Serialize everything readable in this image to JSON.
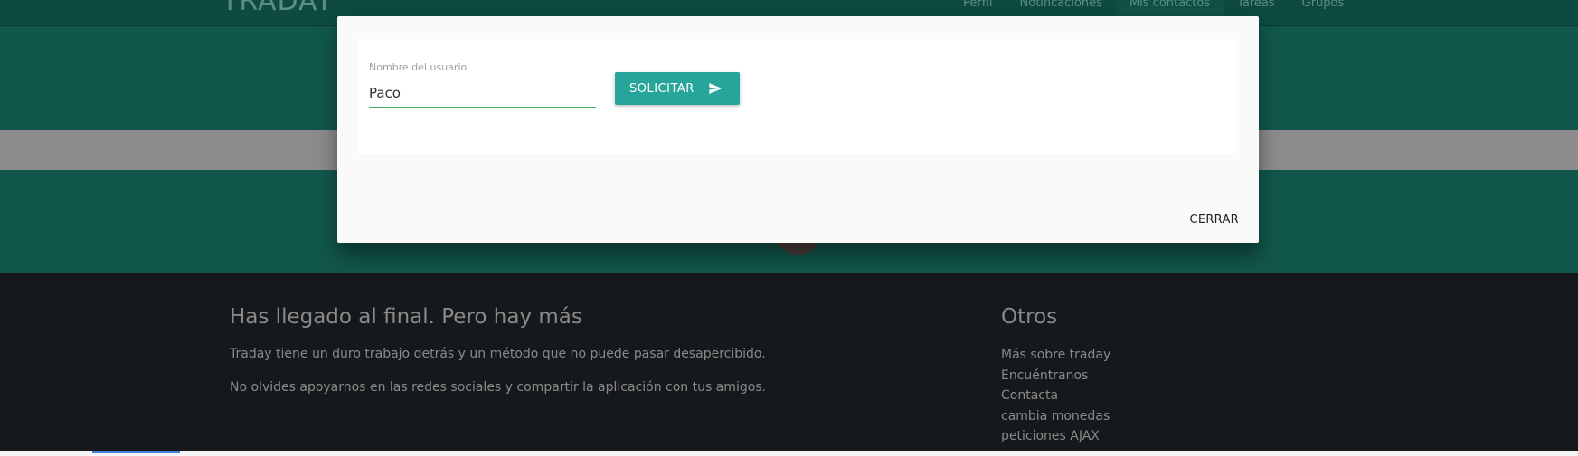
{
  "nav": {
    "brand": "TRADAY",
    "links": [
      "Perfil",
      "Notificaciones",
      "Mis contactos",
      "Tareas",
      "Grupos"
    ]
  },
  "footer": {
    "left_title": "Has llegado al final. Pero hay más",
    "left_p1": "Traday tiene un duro trabajo detrás y un método que no puede pasar desapercibido.",
    "left_p2": "No olvides apoyarnos en las redes sociales y compartir la aplicación con tus amigos.",
    "right_title": "Otros",
    "right_links": [
      "Más sobre traday",
      "Encuéntranos",
      "Contacta",
      "cambia monedas",
      "peticiones AJAX"
    ]
  },
  "modal": {
    "field_label": "Nombre del usuario",
    "field_value": "Paco",
    "submit_label": "SOLICITAR",
    "submit_icon": "send-icon",
    "close_label": "CERRAR"
  },
  "colors": {
    "accent": "#26a69a",
    "input_underline": "#4caf50",
    "teal_band": "#12574c",
    "footer_bg": "#16191b"
  }
}
